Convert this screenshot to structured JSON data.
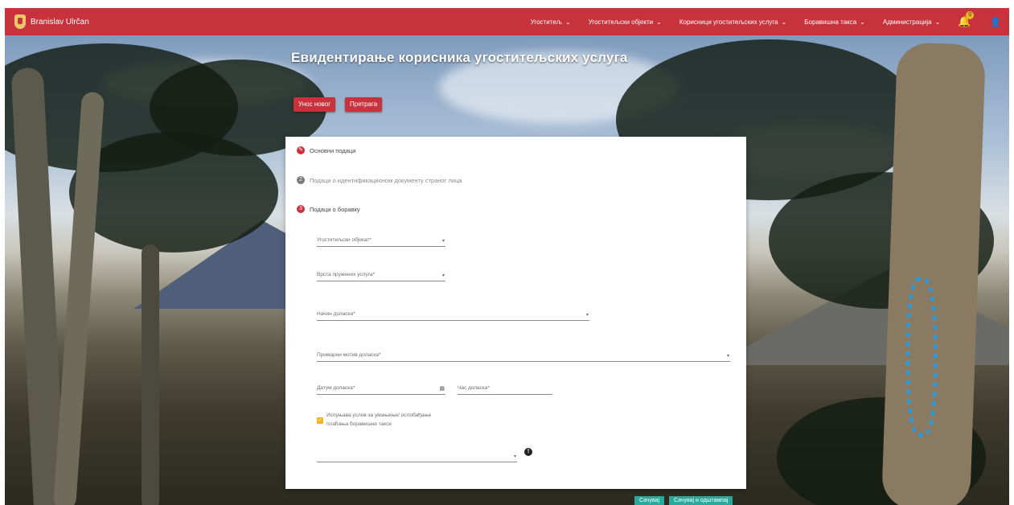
{
  "navbar": {
    "user_name": "Branislav Ulrčan",
    "menu": [
      {
        "label": "Угоститељ"
      },
      {
        "label": "Угоститељски објекти"
      },
      {
        "label": "Корисници угоститељских услуга"
      },
      {
        "label": "Боравишна такса"
      },
      {
        "label": "Администрација"
      }
    ],
    "notification_count": "0"
  },
  "page": {
    "title": "Евидентирање корисника угоститељских услуга",
    "new_entry_label": "Унос новог",
    "search_label": "Претрага"
  },
  "steps": [
    {
      "label": "Основни подаци",
      "icon": "edit-icon",
      "state": "done"
    },
    {
      "label": "Подаци о идентификационом документу страног лица",
      "icon": "2",
      "state": "inactive"
    },
    {
      "label": "Подаци о боравку",
      "icon": "3",
      "state": "active"
    }
  ],
  "form": {
    "facility_label": "Угоститељски објекат*",
    "service_type_label": "Врста пружених услуга*",
    "arrival_method_label": "Начин доласка*",
    "arrival_reason_label": "Примарни мотив доласка*",
    "arrival_date_label": "Датум доласка*",
    "arrival_time_label": "Час доласка*",
    "reduction_checkbox_label": "Испуњава услов за умањење/ ослобађање плаћања боравишне таксе",
    "reduction_checked": true
  },
  "footer": {
    "save_label": "Сачувај",
    "save_print_label": "Сачувај и одштампај"
  },
  "colors": {
    "primary": "#c8323c",
    "accent": "#f0b428",
    "teal": "#2aa89b"
  }
}
